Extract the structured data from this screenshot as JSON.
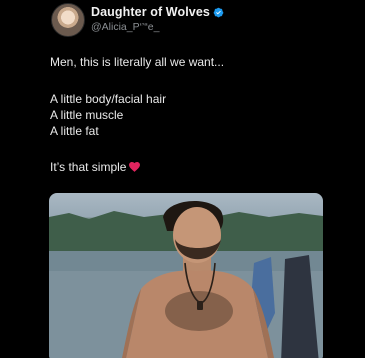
{
  "author": {
    "display_name": "Daughter of Wolves",
    "handle": "@Alicia_P‘’“e_",
    "verified": true,
    "avatar_icon": "profile-photo"
  },
  "tweet": {
    "lines": [
      "Men, this is literally all we want...",
      "A little body/facial hair",
      "A little muscle",
      "A little fat",
      "It’s that simple"
    ],
    "trailing_emoji": "red-heart-icon"
  },
  "media": {
    "type": "photo",
    "description_icon": "attached-photo"
  },
  "colors": {
    "background": "#000000",
    "text": "#e7e9ea",
    "secondary_text": "#8b8f93",
    "verified_blue": "#1d9bf0",
    "heart_red": "#e0245e"
  }
}
